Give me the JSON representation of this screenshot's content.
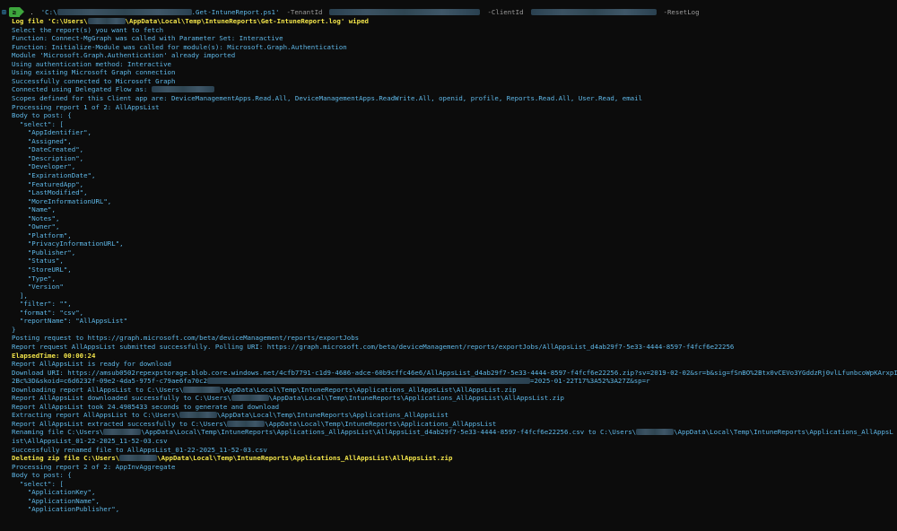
{
  "prompt": {
    "dot": ".",
    "path_prefix": "'C:\\",
    "path_suffix": ".Get-IntuneReport.ps1'",
    "param_tenant": "-TenantId",
    "param_client": "-ClientId",
    "param_reset": "-ResetLog"
  },
  "lines": [
    {
      "parts": [
        {
          "t": "Log file 'C:\\Users\\",
          "c": "yellow"
        },
        {
          "r": 42
        },
        {
          "t": "\\AppData\\Local\\Temp\\IntuneReports\\Get-IntuneReport.log' wiped",
          "c": "yellow"
        }
      ]
    },
    {
      "parts": [
        {
          "t": "Select the report(s) you want to fetch"
        }
      ]
    },
    {
      "parts": [
        {
          "t": "Function: Connect-MgGraph was called with Parameter Set: Interactive"
        }
      ]
    },
    {
      "parts": [
        {
          "t": "Function: Initialize-Module was called for module(s): Microsoft.Graph.Authentication"
        }
      ]
    },
    {
      "parts": [
        {
          "t": "Module 'Microsoft.Graph.Authentication' already imported"
        }
      ]
    },
    {
      "parts": [
        {
          "t": "Using authentication method: Interactive"
        }
      ]
    },
    {
      "parts": [
        {
          "t": "Using existing Microsoft Graph connection"
        }
      ]
    },
    {
      "parts": [
        {
          "t": "Successfully connected to Microsoft Graph"
        }
      ]
    },
    {
      "parts": [
        {
          "t": "Connected using Delegated Flow as: "
        },
        {
          "r": 70
        }
      ]
    },
    {
      "parts": [
        {
          "t": "Scopes defined for this Client app are: DeviceManagementApps.Read.All, DeviceManagementApps.ReadWrite.All, openid, profile, Reports.Read.All, User.Read, email"
        }
      ]
    },
    {
      "parts": [
        {
          "t": "Processing report 1 of 2: AllAppsList"
        }
      ]
    },
    {
      "parts": [
        {
          "t": "Body to post: {"
        }
      ]
    },
    {
      "parts": [
        {
          "t": "  \"select\": ["
        }
      ]
    },
    {
      "parts": [
        {
          "t": "    \"AppIdentifier\","
        }
      ]
    },
    {
      "parts": [
        {
          "t": "    \"Assigned\","
        }
      ]
    },
    {
      "parts": [
        {
          "t": "    \"DateCreated\","
        }
      ]
    },
    {
      "parts": [
        {
          "t": "    \"Description\","
        }
      ]
    },
    {
      "parts": [
        {
          "t": "    \"Developer\","
        }
      ]
    },
    {
      "parts": [
        {
          "t": "    \"ExpirationDate\","
        }
      ]
    },
    {
      "parts": [
        {
          "t": "    \"FeaturedApp\","
        }
      ]
    },
    {
      "parts": [
        {
          "t": "    \"LastModified\","
        }
      ]
    },
    {
      "parts": [
        {
          "t": "    \"MoreInformationURL\","
        }
      ]
    },
    {
      "parts": [
        {
          "t": "    \"Name\","
        }
      ]
    },
    {
      "parts": [
        {
          "t": "    \"Notes\","
        }
      ]
    },
    {
      "parts": [
        {
          "t": "    \"Owner\","
        }
      ]
    },
    {
      "parts": [
        {
          "t": "    \"Platform\","
        }
      ]
    },
    {
      "parts": [
        {
          "t": "    \"PrivacyInformationURL\","
        }
      ]
    },
    {
      "parts": [
        {
          "t": "    \"Publisher\","
        }
      ]
    },
    {
      "parts": [
        {
          "t": "    \"Status\","
        }
      ]
    },
    {
      "parts": [
        {
          "t": "    \"StoreURL\","
        }
      ]
    },
    {
      "parts": [
        {
          "t": "    \"Type\","
        }
      ]
    },
    {
      "parts": [
        {
          "t": "    \"Version\""
        }
      ]
    },
    {
      "parts": [
        {
          "t": "  ],"
        }
      ]
    },
    {
      "parts": [
        {
          "t": "  \"filter\": \"\","
        }
      ]
    },
    {
      "parts": [
        {
          "t": "  \"format\": \"csv\","
        }
      ]
    },
    {
      "parts": [
        {
          "t": "  \"reportName\": \"AllAppsList\""
        }
      ]
    },
    {
      "parts": [
        {
          "t": "}"
        }
      ]
    },
    {
      "parts": [
        {
          "t": "Posting request to https://graph.microsoft.com/beta/deviceManagement/reports/exportJobs"
        }
      ]
    },
    {
      "parts": [
        {
          "t": "Report request AllAppsList submitted successfully. Polling URI: https://graph.microsoft.com/beta/deviceManagement/reports/exportJobs/AllAppsList_d4ab29f7-5e33-4444-8597-f4fcf6e22256"
        }
      ]
    },
    {
      "parts": [
        {
          "t": "ElapsedTime: 00:00:24",
          "c": "yellow"
        }
      ]
    },
    {
      "parts": [
        {
          "t": "Report AllAppsList is ready for download"
        }
      ]
    },
    {
      "parts": [
        {
          "t": "Download URI: https://amsub0502repexpstorage.blob.core.windows.net/4cfb7791-c1d9-4686-adce-60b9cffc46e6/AllAppsList_d4ab29f7-5e33-4444-8597-f4fcf6e22256.zip?sv=2019-02-02&sr=b&sig=fSnBO%2Btx0vCEVo3YGddzRj0vlLfunbcoWpKArxpIp%"
        }
      ]
    },
    {
      "parts": [
        {
          "t": "2Bc%3D&skoid=c6d6232f-09e2-4da5-975f-c79ae6fa70c2"
        },
        {
          "r": 360
        },
        {
          "t": "=2025-01-22T17%3A52%3A27Z&sp=r"
        }
      ]
    },
    {
      "parts": [
        {
          "t": "Downloading report AllAppsList to C:\\Users\\"
        },
        {
          "r": 42
        },
        {
          "t": "\\AppData\\Local\\Temp\\IntuneReports\\Applications_AllAppsList\\AllAppsList.zip"
        }
      ]
    },
    {
      "parts": [
        {
          "t": "Report AllAppsList downloaded successfully to C:\\Users\\"
        },
        {
          "r": 42
        },
        {
          "t": "\\AppData\\Local\\Temp\\IntuneReports\\Applications_AllAppsList\\AllAppsList.zip"
        }
      ]
    },
    {
      "parts": [
        {
          "t": "Report AllAppsList took 24.4985433 seconds to generate and download"
        }
      ]
    },
    {
      "parts": [
        {
          "t": "Extracting report AllAppsList to C:\\Users\\"
        },
        {
          "r": 42
        },
        {
          "t": "\\AppData\\Local\\Temp\\IntuneReports\\Applications_AllAppsList"
        }
      ]
    },
    {
      "parts": [
        {
          "t": "Report AllAppsList extracted successfully to C:\\Users\\"
        },
        {
          "r": 42
        },
        {
          "t": "\\AppData\\Local\\Temp\\IntuneReports\\Applications_AllAppsList"
        }
      ]
    },
    {
      "parts": [
        {
          "t": "Renaming file C:\\Users\\"
        },
        {
          "r": 42
        },
        {
          "t": "\\AppData\\Local\\Temp\\IntuneReports\\Applications_AllAppsList\\AllAppsList_d4ab29f7-5e33-4444-8597-f4fcf6e22256.csv to C:\\Users\\"
        },
        {
          "r": 42
        },
        {
          "t": "\\AppData\\Local\\Temp\\IntuneReports\\Applications_AllAppsL"
        }
      ]
    },
    {
      "parts": [
        {
          "t": "ist\\AllAppsList_01-22-2025_11-52-03.csv"
        }
      ]
    },
    {
      "parts": [
        {
          "t": "Successfully renamed file to AllAppsList_01-22-2025_11-52-03.csv"
        }
      ]
    },
    {
      "parts": [
        {
          "t": "Deleting zip file C:\\Users\\",
          "c": "yellow"
        },
        {
          "r": 42
        },
        {
          "t": "\\AppData\\Local\\Temp\\IntuneReports\\Applications_AllAppsList\\AllAppsList.zip",
          "c": "yellow"
        }
      ]
    },
    {
      "parts": [
        {
          "t": "Processing report 2 of 2: AppInvAggregate"
        }
      ]
    },
    {
      "parts": [
        {
          "t": "Body to post: {"
        }
      ]
    },
    {
      "parts": [
        {
          "t": "  \"select\": ["
        }
      ]
    },
    {
      "parts": [
        {
          "t": "    \"ApplicationKey\","
        }
      ]
    },
    {
      "parts": [
        {
          "t": "    \"ApplicationName\","
        }
      ]
    },
    {
      "parts": [
        {
          "t": "    \"ApplicationPublisher\","
        }
      ]
    }
  ],
  "colors": {
    "background": "#0c0c0c",
    "default_text": "#5fb8e8",
    "highlight_text": "#f2e44a",
    "badge": "#3da63d"
  }
}
